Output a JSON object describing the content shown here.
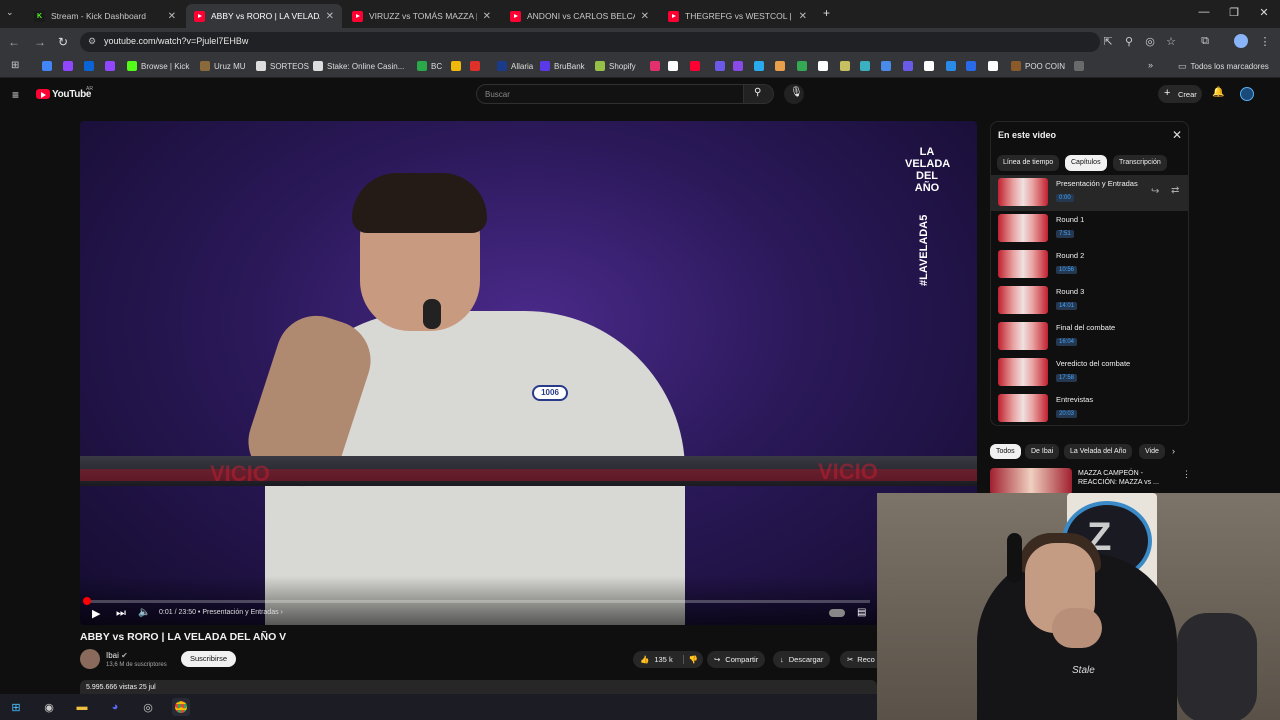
{
  "browser": {
    "tabs": [
      {
        "title": "Stream - Kick Dashboard",
        "icon": "kick-icon",
        "active": false
      },
      {
        "title": "ABBY vs RORO | LA VELADA DEL",
        "icon": "youtube-icon",
        "active": true
      },
      {
        "title": "VIRUZZ vs TOMÁS MAZZA | LA",
        "icon": "youtube-icon",
        "active": false
      },
      {
        "title": "ANDONI vs CARLOS BELCAST",
        "icon": "youtube-icon",
        "active": false
      },
      {
        "title": "THEGREFG vs WESTCOL | LA VE",
        "icon": "youtube-icon",
        "active": false
      }
    ],
    "url": "youtube.com/watch?v=Pjulel7EHBw",
    "bookmarks": [
      {
        "label": "",
        "icon": "google-icon",
        "color": "#4285f4"
      },
      {
        "label": "",
        "icon": "twitch-icon",
        "color": "#9146ff"
      },
      {
        "label": "",
        "icon": "outlook-icon",
        "color": "#0a64d6"
      },
      {
        "label": "",
        "icon": "twitch-icon",
        "color": "#9146ff"
      },
      {
        "label": "Browse | Kick",
        "icon": "kick-icon",
        "color": "#53fc18"
      },
      {
        "label": "Uruz MU",
        "icon": "uruz-icon",
        "color": "#8a6a3a"
      },
      {
        "label": "SORTEOS",
        "icon": "diamond-icon",
        "color": "#dddddd"
      },
      {
        "label": "Stake: Online Casin...",
        "icon": "stake-icon",
        "color": "#dddddd"
      },
      {
        "label": "BC",
        "icon": "bc-icon",
        "color": "#2aa84a"
      },
      {
        "label": "",
        "icon": "binance-icon",
        "color": "#f0b90b"
      },
      {
        "label": "",
        "icon": "red-icon",
        "color": "#e0302a"
      },
      {
        "label": "Allaria",
        "icon": "allaria-icon",
        "color": "#1a3a8a"
      },
      {
        "label": "BruBank",
        "icon": "brubank-icon",
        "color": "#5a3ae8"
      },
      {
        "label": "Shopify",
        "icon": "shopify-icon",
        "color": "#95bf47"
      },
      {
        "label": "POO COIN",
        "icon": "poocoin-icon",
        "color": "#8a5a2a"
      }
    ],
    "all_bookmarks_label": "Todos los marcadores"
  },
  "youtube": {
    "logo_text": "YouTube",
    "country": "AR",
    "search_placeholder": "Buscar",
    "create_label": "Crear",
    "video": {
      "title": "ABBY vs RORO | LA VELADA DEL AÑO V",
      "time": "0:01 / 23:50",
      "chapter": "Presentación y Entradas",
      "progress_fraction": 0.001,
      "overlay_logo": "LA VELADA DEL AÑO",
      "overlay_hashtag": "#LAVELADA5",
      "ring_text": "VICIO",
      "badge": "1006"
    },
    "channel": {
      "name": "Ibai",
      "subs": "13,6 M de suscriptores",
      "subscribe_label": "Suscribirse"
    },
    "actions": {
      "likes": "135 k",
      "share": "Compartir",
      "download": "Descargar",
      "clip": "Reco"
    },
    "views_line": "5.995.666 vistas  25 jul",
    "panel": {
      "title": "En este video",
      "tabs": [
        "Línea de tiempo",
        "Capítulos",
        "Transcripción"
      ],
      "active_tab": 1,
      "chapters": [
        {
          "title": "Presentación y Entradas",
          "time": "0:00"
        },
        {
          "title": "Round 1",
          "time": "7:51"
        },
        {
          "title": "Round 2",
          "time": "10:56"
        },
        {
          "title": "Round 3",
          "time": "14:01"
        },
        {
          "title": "Final del combate",
          "time": "16:04"
        },
        {
          "title": "Veredicto del combate",
          "time": "17:58"
        },
        {
          "title": "Entrevistas",
          "time": "20:03"
        }
      ]
    },
    "chips": [
      "Todos",
      "De Ibai",
      "La Velada del Año",
      "Vide"
    ],
    "related": {
      "title": "MAZZA CAMPEÓN - REACCIÓN: MAZZA vs ..."
    }
  },
  "webcam": {
    "logo_letter": "Z",
    "shirt_text": "Stale"
  }
}
